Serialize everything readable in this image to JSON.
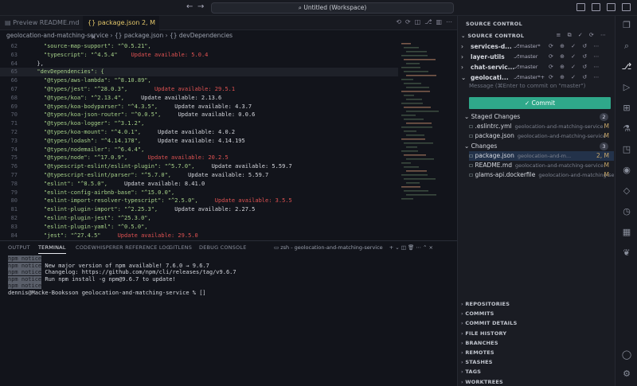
{
  "titlebar": {
    "title": "Untitled (Workspace)",
    "back": "←",
    "forward": "→"
  },
  "tabs": [
    {
      "label": "Preview README.md"
    },
    {
      "label": "package.json 2, M"
    }
  ],
  "breadcrumb": {
    "text": "geolocation-and-matching-service  ›  {} package.json  ›  {} devDependencies"
  },
  "editor": {
    "lines": [
      {
        "n": "62",
        "text": "    \"source-map-support\": \"^0.5.21\","
      },
      {
        "n": "63",
        "text": "    \"typescript\": \"^4.5.4\"    Update available: 5.0.4"
      },
      {
        "n": "64",
        "text": "  },"
      },
      {
        "n": "65",
        "text": "  \"devDependencies\": {"
      },
      {
        "n": "66",
        "text": "    \"@types/aws-lambda\": \"^8.10.89\","
      },
      {
        "n": "67",
        "text": "    \"@types/jest\": \"^28.0.3\",        Update available: 29.5.1"
      },
      {
        "n": "68",
        "text": "    \"@types/koa\": \"^2.13.4\",     Update available: 2.13.6"
      },
      {
        "n": "69",
        "text": "    \"@types/koa-bodyparser\": \"^4.3.5\",     Update available: 4.3.7"
      },
      {
        "n": "70",
        "text": "    \"@types/koa-json-router\": \"^0.0.5\",     Update available: 0.0.6"
      },
      {
        "n": "71",
        "text": "    \"@types/koa-logger\": \"^3.1.2\","
      },
      {
        "n": "72",
        "text": "    \"@types/koa-mount\": \"^4.0.1\",     Update available: 4.0.2"
      },
      {
        "n": "73",
        "text": "    \"@types/lodash\": \"^4.14.178\",     Update available: 4.14.195"
      },
      {
        "n": "74",
        "text": "    \"@types/nodemailer\": \"^6.4.4\","
      },
      {
        "n": "75",
        "text": "    \"@types/node\": \"^17.0.9\",      Update available: 20.2.5"
      },
      {
        "n": "76",
        "text": "    \"@typescript-eslint/eslint-plugin\": \"^5.7.0\",     Update available: 5.59.7"
      },
      {
        "n": "77",
        "text": "    \"@typescript-eslint/parser\": \"^5.7.0\",     Update available: 5.59.7"
      },
      {
        "n": "78",
        "text": "    \"eslint\": \"^8.5.0\",     Update available: 8.41.0"
      },
      {
        "n": "79",
        "text": "    \"eslint-config-airbnb-base\": \"^15.0.0\","
      },
      {
        "n": "80",
        "text": "    \"eslint-import-resolver-typescript\": \"^2.5.0\",     Update available: 3.5.5"
      },
      {
        "n": "81",
        "text": "    \"eslint-plugin-import\": \"^2.25.3\",     Update available: 2.27.5"
      },
      {
        "n": "82",
        "text": "    \"eslint-plugin-jest\": \"^25.3.0\","
      },
      {
        "n": "83",
        "text": "    \"eslint-plugin-yaml\": \"^0.5.0\","
      },
      {
        "n": "84",
        "text": "    \"jest\": \"^27.4.5\"     Update available: 29.5.0"
      },
      {
        "n": "85",
        "text": "  }"
      },
      {
        "n": "86",
        "text": "}"
      }
    ]
  },
  "panel": {
    "tabs": [
      "OUTPUT",
      "TERMINAL",
      "CODEWHISPERER REFERENCE LOG",
      "GITLENS",
      "DEBUG CONSOLE"
    ],
    "session": "zsh - geolocation-and-matching-service",
    "terminal": [
      {
        "tag": "npm notice",
        "text": ""
      },
      {
        "tag": "npm notice",
        "text": " New major version of npm available! 7.6.0 → 9.6.7"
      },
      {
        "tag": "npm notice",
        "text": " Changelog: https://github.com/npm/cli/releases/tag/v9.6.7"
      },
      {
        "tag": "npm notice",
        "text": " Run npm install -g npm@9.6.7 to update!"
      },
      {
        "tag": "npm notice",
        "text": ""
      },
      {
        "tag": "",
        "text": "dennis@Macke-Booksson geolocation-and-matching-service % []"
      }
    ]
  },
  "sidebar": {
    "title": "SOURCE CONTROL",
    "section": "SOURCE CONTROL",
    "repos": [
      {
        "name": "services-d...",
        "branch": "master*"
      },
      {
        "name": "layer-utils",
        "branch": "master"
      },
      {
        "name": "chat-servic...",
        "branch": "master"
      },
      {
        "name": "geolocati...",
        "branch": "master*+"
      }
    ],
    "commit_placeholder": "Message (⌘Enter to commit on \"master\")",
    "commit_label": "✓ Commit",
    "staged_label": "Staged Changes",
    "staged_count": "2",
    "staged": [
      {
        "name": ".eslintrc.yml",
        "path": "geolocation-and-matching-service",
        "status": "M"
      },
      {
        "name": "package.json",
        "path": "geolocation-and-matching-service",
        "status": "M"
      }
    ],
    "changes_label": "Changes",
    "changes_count": "3",
    "changes": [
      {
        "name": "package.json",
        "path": "geolocation-and-m...",
        "status": "2, M"
      },
      {
        "name": "README.md",
        "path": "geolocation-and-matching-service",
        "status": "M"
      },
      {
        "name": "glams-api.dockerfile",
        "path": "geolocation-and-matching-se...",
        "status": "M"
      }
    ],
    "bottom_sections": [
      "REPOSITORIES",
      "COMMITS",
      "COMMIT DETAILS",
      "FILE HISTORY",
      "BRANCHES",
      "REMOTES",
      "STASHES",
      "TAGS",
      "WORKTREES"
    ]
  },
  "colors": {
    "accent": "#2fa88a",
    "warning": "#e05252",
    "active_tab": "#e3c66a"
  }
}
